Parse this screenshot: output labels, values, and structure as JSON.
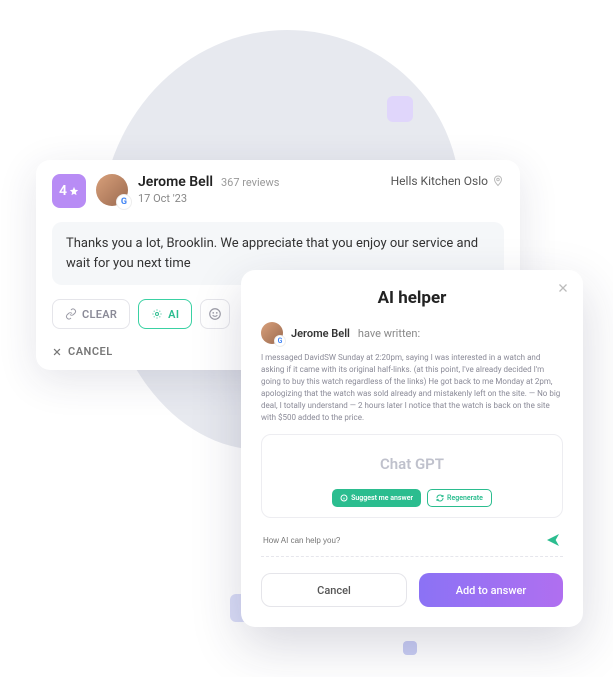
{
  "review": {
    "rating": "4",
    "author": "Jerome Bell",
    "review_count": "367 reviews",
    "date": "17 Oct '23",
    "location": "Hells Kitchen Oslo",
    "reply_text": "Thanks you a lot, Brooklin. We appreciate that you enjoy our service and wait for you next time",
    "actions": {
      "clear": "CLEAR",
      "ai": "AI",
      "cancel": "CANCEL"
    }
  },
  "ai_panel": {
    "title": "AI helper",
    "author": "Jerome Bell",
    "written_suffix": "have written:",
    "quote": "I messaged DavidSW Sunday at 2:20pm, saying I was interested in a watch and asking if it came with its original half-links. (at this point, I've already decided I'm going to buy this watch regardless of the links) He got back to me Monday at 2pm, apologizing that the watch was sold already and mistakenly left on the site. — No big deal, I totally understand — 2 hours later I notice that the watch is back on the site with $500 added to the price.",
    "engine_label": "Chat GPT",
    "suggest_btn": "Suggest me answer",
    "regenerate_btn": "Regenerate",
    "input_placeholder": "How AI can help you?",
    "cancel_btn": "Cancel",
    "add_btn": "Add to answer"
  }
}
